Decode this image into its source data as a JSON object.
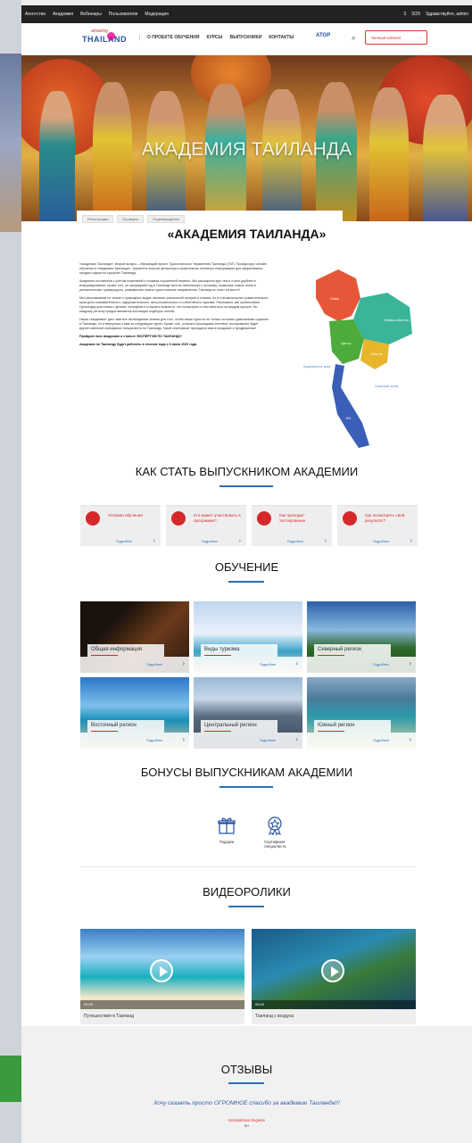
{
  "adminbar": {
    "items": [
      "Агентства",
      "Академия",
      "Вебинары",
      "Пользователи",
      "Модерация"
    ],
    "right": [
      "3",
      "3/29",
      "Здравствуйте, admin"
    ]
  },
  "header": {
    "logo_top": "amazing",
    "logo_main": "THAILAND",
    "nav": [
      "О ПРОЕКТЕ ОБУЧЕНИЯ",
      "КУРСЫ",
      "ВЫПУСКНИКИ",
      "КОНТАКТЫ"
    ],
    "partner": "АТОР",
    "cabinet": "Личный кабинет"
  },
  "hero": {
    "title": "АКАДЕМИЯ ТАИЛАНДА"
  },
  "crumbs": [
    "Регистрация",
    "Проверка",
    "Подтверждение"
  ],
  "intro": {
    "heading": "«АКАДЕМИЯ ТАИЛАНДА»",
    "p1": "«Академия Таиланда», второй выпуск – обучающий проект Туристического Управления Таиланда (ТАТ). Пройдя курс онлайн обучения в «Академии Таиланда», турагенты получат детальную и практически полезную информацию для эффективных продаж отдыха на курортах Таиланда.",
    "p2": "Академия составлена с учётом пожеланий и отзывов слушателей первого. Мы расширили круг тем и стали удобнее в информировании, кроме того, за прошедший год в Таиланде многое изменилось к лучшему, появились новые отели и увлекательные турмаршруты, развивались новые туристические направления. Таиланд не стоит на месте!",
    "p3": "Мы рассказываем не только о природных видах, величии уникальной истории и пляжах, но и о возможностях романтического, культурно-познавательного, оздоровительного, гастрономического и событийного туризма. Расскажем, как организовать турпоездку для семьи с детьми, молодёжи и старшего возраста, что посмотреть и чем заняться на каждом курорте. Во каждому региону предоставляются коллекции подборок отелей.",
    "p4": "Наша «Академия» даст вам все необходимые знания для того, чтобы ваши туристы не только остались довольными отдыхом в Таиланде, но и вернулись к вам за следующим туром. Кроме того, успешно прошедшим итоговое тестирование будет вручен именной сертификат специалиста по Таиланду. Такой сертификат пригодится вам в продажах и продвижении!",
    "p5": "Пройдите всю Академию и станьте ЭКСПЕРТОМ ПО ТАИЛАНДУ!",
    "p6": "Академия по Таиланду будет работать в течение года с 6 июля 2020 года."
  },
  "map": {
    "regions": [
      "Север",
      "Северо-Восток",
      "Центр",
      "Восток",
      "Юг"
    ],
    "labels": [
      "Андаманское море",
      "Сиамский залив"
    ]
  },
  "steps": {
    "title": "КАК СТАТЬ ВЫПУСКНИКОМ АКАДЕМИИ",
    "more": "Подробнее",
    "items": [
      "Условия обучения",
      "Кто может участвовать в программе?",
      "Как проходит тестирование",
      "Где посмотреть свой результат?"
    ]
  },
  "learning": {
    "title": "ОБУЧЕНИЕ",
    "more": "Подробнее",
    "items": [
      "Общая информация",
      "Виды туризма",
      "Северный регион",
      "Восточный регион",
      "Центральный регион",
      "Южный регион"
    ]
  },
  "bonus": {
    "title": "БОНУСЫ ВЫПУСКНИКАМ АКАДЕМИИ",
    "items": [
      "Подарки",
      "Сертификат специалиста"
    ]
  },
  "videos": {
    "title": "ВИДЕОРОЛИКИ",
    "items": [
      "Путешествия в Таиланд",
      "Таиланд с воздуха"
    ],
    "time": "00:00"
  },
  "reviews": {
    "title": "ОТЗЫВЫ",
    "quote": "Хочу сказать просто ОГРОМНОЕ спасибо за академию Таиланда!!!",
    "name": "Kostantinova Evgenia",
    "city": "ВН"
  }
}
